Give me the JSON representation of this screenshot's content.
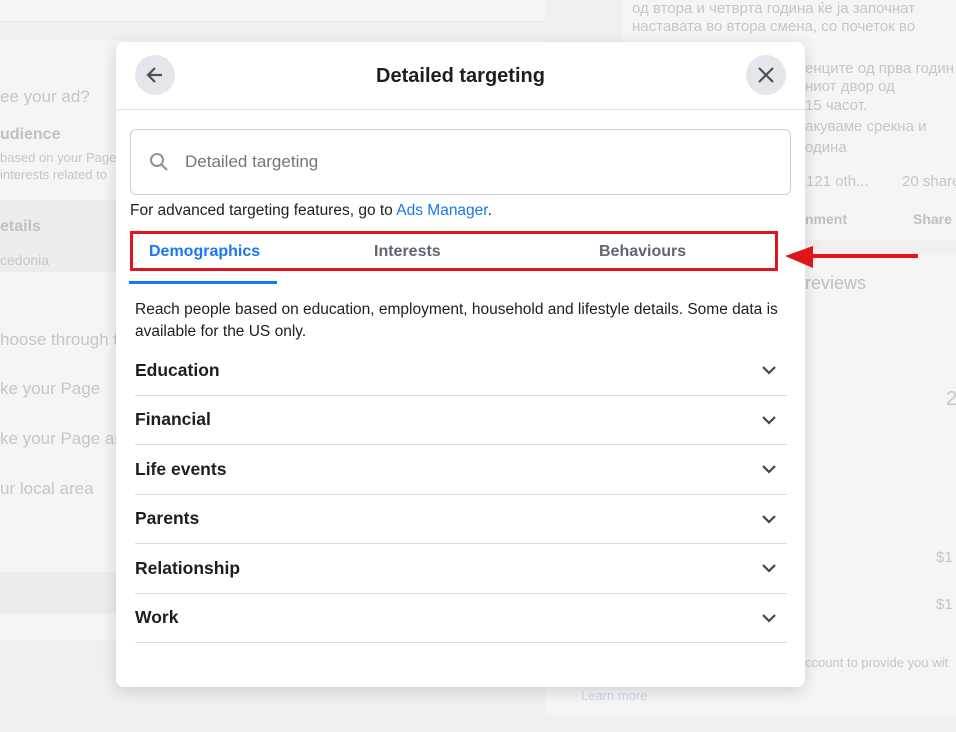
{
  "background": {
    "left": [
      "ee your ad?",
      "udience",
      "based on your Page",
      "interests related to",
      "etails",
      "cedonia",
      "hoose through t",
      "ke your Page",
      "ke your Page ar",
      "ur local area"
    ],
    "right": [
      "од втора и четврта година ќе ја започнат",
      "наставата во втора смена, со почеток во",
      "енците од прва годин",
      "ниот двор од",
      "15 часот.",
      "акуваме срекна и",
      "одина",
      "121 oth...",
      "20 share",
      "nment",
      "Share",
      "reviews",
      "2",
      "$1",
      "$1",
      "ccount to provide you wit",
      "Learn more"
    ]
  },
  "modal": {
    "title": "Detailed targeting",
    "back_icon": "arrow-left-icon",
    "close_icon": "close-icon",
    "search": {
      "placeholder": "Detailed targeting",
      "value": ""
    },
    "advanced_prefix": "For advanced targeting features, go to ",
    "advanced_link": "Ads Manager",
    "advanced_suffix": ".",
    "tabs": [
      {
        "label": "Demographics",
        "active": true
      },
      {
        "label": "Interests"
      },
      {
        "label": "Behaviours"
      }
    ],
    "description": "Reach people based on education, employment, household and lifestyle details. Some data is available for the US only.",
    "categories": [
      "Education",
      "Financial",
      "Life events",
      "Parents",
      "Relationship",
      "Work"
    ]
  },
  "colors": {
    "accent": "#1877f2",
    "highlight": "#e0141c"
  }
}
